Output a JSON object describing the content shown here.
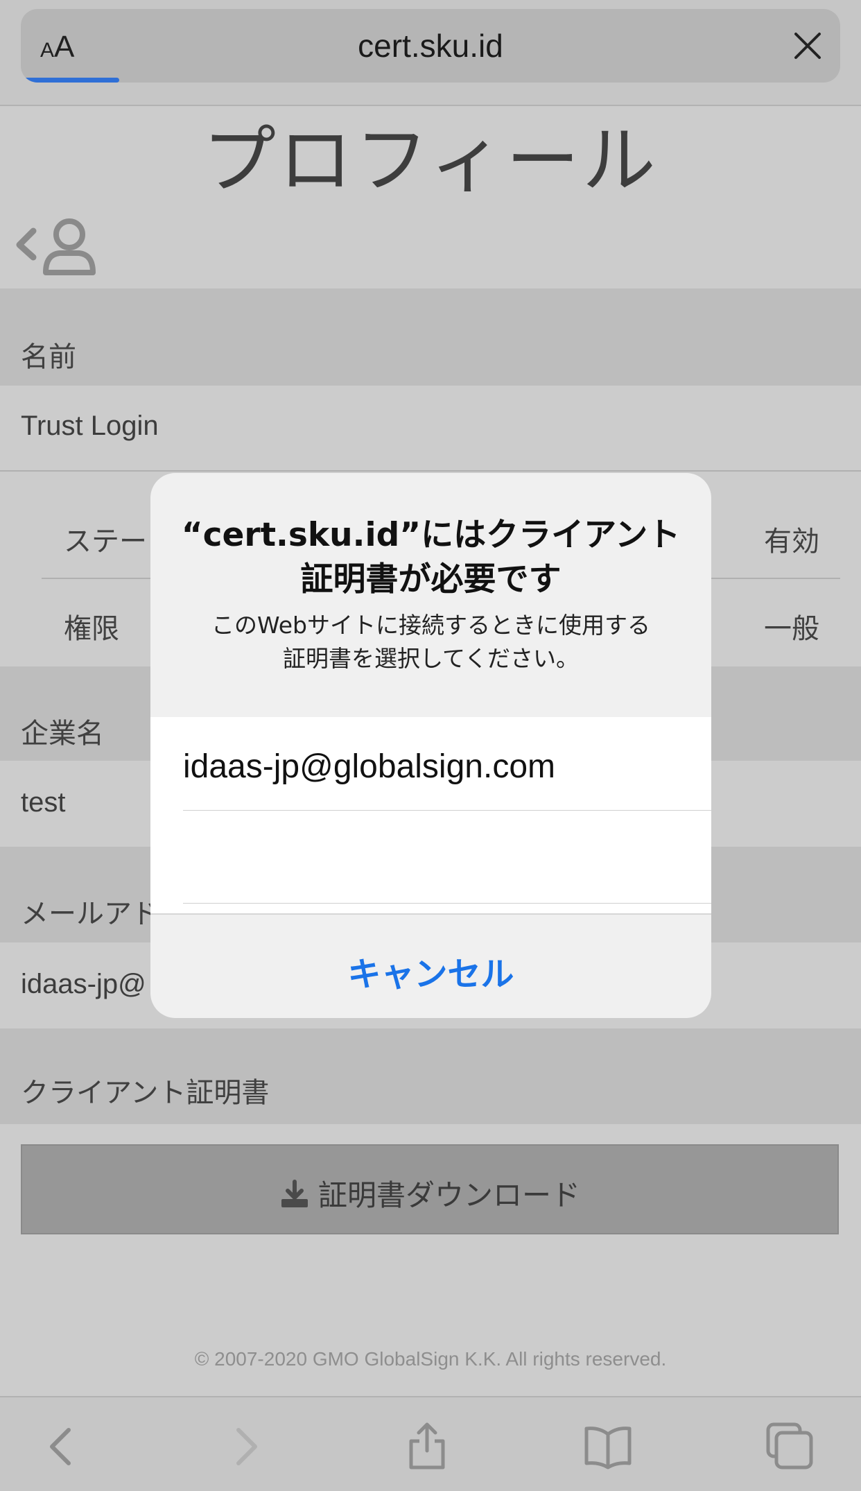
{
  "browser": {
    "text_size_label_small": "A",
    "text_size_label_large": "A",
    "url": "cert.sku.id",
    "close_icon": "close-icon",
    "progress": 0.12
  },
  "page": {
    "title": "プロフィール",
    "back_icon": "chevron-left-icon",
    "user_icon": "user-icon",
    "sections": {
      "name_label": "名前",
      "name_value": "Trust Login",
      "status_label": "ステー",
      "status_value": "有効",
      "role_label": "権限",
      "role_value": "一般",
      "company_label": "企業名",
      "company_value": "test",
      "email_label": "メールアド",
      "email_value": "idaas-jp@",
      "cert_label": "クライアント証明書"
    },
    "download_button": "証明書ダウンロード",
    "footer": "© 2007-2020 GMO GlobalSign K.K. All rights reserved."
  },
  "dialog": {
    "title_line1": "“cert.sku.id”にはクライアント",
    "title_line2": "証明書が必要です",
    "message_line1": "このWebサイトに接続するときに使用する",
    "message_line2": "証明書を選択してください。",
    "certificates": [
      "idaas-jp@globalsign.com"
    ],
    "cancel": "キャンセル",
    "cancel_color": "#1a73e8"
  },
  "toolbar": {
    "icons": [
      "back-icon",
      "forward-icon",
      "share-icon",
      "bookmarks-icon",
      "tabs-icon"
    ]
  }
}
